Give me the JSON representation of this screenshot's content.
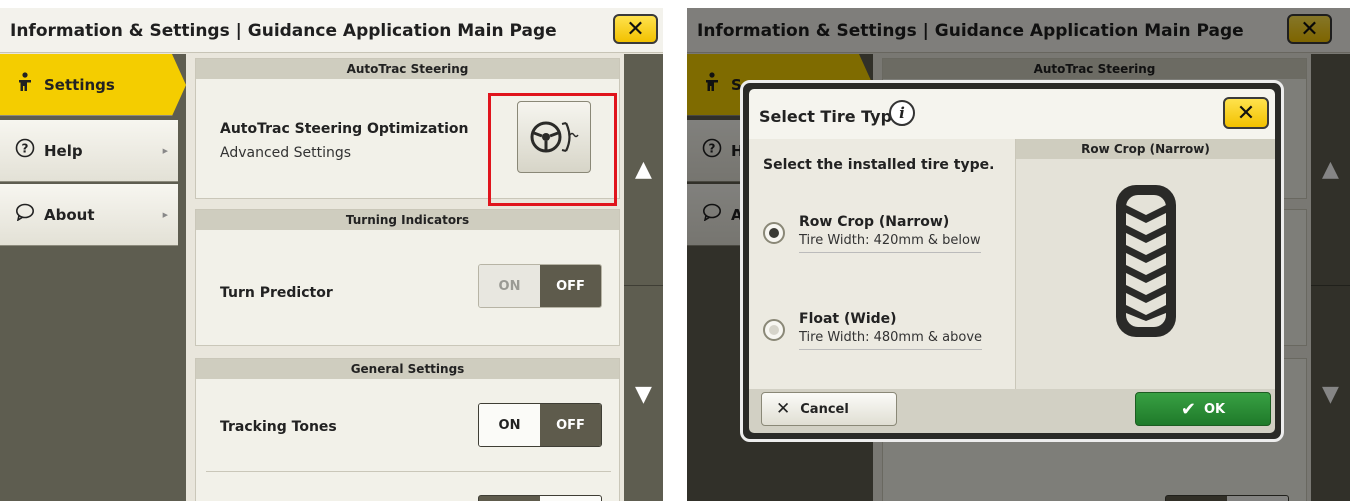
{
  "left_screen": {
    "title": "Information & Settings | Guidance Application Main Page",
    "close_icon": "close-x-icon",
    "sidebar": {
      "items": [
        {
          "label": "Settings",
          "icon": "person-icon",
          "active": true
        },
        {
          "label": "Help",
          "icon": "help-icon",
          "active": false
        },
        {
          "label": "About",
          "icon": "chat-icon",
          "active": false
        }
      ]
    },
    "sections": {
      "autotrac": {
        "header": "AutoTrac Steering",
        "row_title": "AutoTrac Steering Optimization",
        "row_sub": "Advanced Settings",
        "button_icon": "steering-wheel-icon"
      },
      "turning": {
        "header": "Turning Indicators",
        "row_title": "Turn Predictor",
        "on_label": "ON",
        "off_label": "OFF",
        "selected": "OFF"
      },
      "general": {
        "header": "General Settings",
        "row_title": "Tracking Tones",
        "on_label": "ON",
        "off_label": "OFF",
        "selected": "OFF"
      }
    },
    "colors": {
      "accent": "#f4cd00",
      "highlight": "#e0141c",
      "sidebar_bg": "#5e5d50"
    }
  },
  "right_screen": {
    "title": "Information & Settings | Guidance Application Main Page",
    "bg_section_header": "AutoTrac Steering",
    "sidebar_items": [
      {
        "label": "Se",
        "icon": "person-icon"
      },
      {
        "label": "He",
        "icon": "help-icon"
      },
      {
        "label": "Ab",
        "icon": "chat-icon"
      }
    ],
    "dialog": {
      "title": "Select Tire Type",
      "info_icon": "i",
      "prompt": "Select the installed tire type.",
      "options": [
        {
          "name": "Row Crop (Narrow)",
          "width": "Tire Width: 420mm & below",
          "selected": true
        },
        {
          "name": "Float (Wide)",
          "width": "Tire Width: 480mm & above",
          "selected": false
        }
      ],
      "preview_header": "Row Crop (Narrow)",
      "cancel_label": "Cancel",
      "ok_label": "OK",
      "colors": {
        "ok": "#2e8f38"
      }
    }
  }
}
